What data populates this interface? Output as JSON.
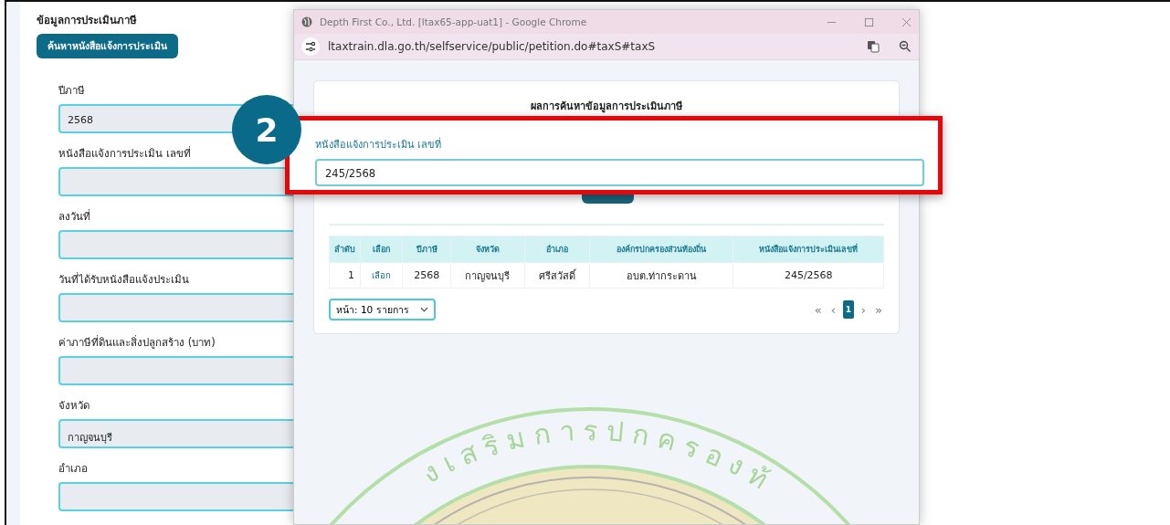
{
  "form": {
    "title": "ข้อมูลการประเมินภาษี",
    "search_button": "ค้นหาหนังสือแจ้งการประเมิน",
    "fields": [
      {
        "label": "ปีภาษี",
        "value": "2568"
      },
      {
        "label": "หนังสือแจ้งการประเมิน เลขที่"
      },
      {
        "label": "ลงวันที่"
      },
      {
        "label": "วันที่ได้รับหนังสือแจ้งประเมิน"
      },
      {
        "label": "ค่าภาษีที่ดินและสิ่งปลูกสร้าง (บาท)"
      },
      {
        "label": "จังหวัด",
        "value": "กาญจนบุรี"
      },
      {
        "label": "อำเภอ"
      }
    ]
  },
  "popup": {
    "window_title": "Depth First Co., Ltd. [ltax65-app-uat1] - Google Chrome",
    "url": "ltaxtrain.dla.go.th/selfservice/public/petition.do#taxS#taxS",
    "card_title": "ผลการค้นหาข้อมูลการประเมินภาษี",
    "table": {
      "columns": [
        "ลำดับ",
        "เลือก",
        "ปีภาษี",
        "จังหวัด",
        "อำเภอ",
        "องค์กรปกครองส่วนท้องถิ่น",
        "หนังสือแจ้งการประเมินเลขที่"
      ],
      "rows": [
        {
          "no": "1",
          "select": "เลือก",
          "year": "2568",
          "province": "กาญจนบุรี",
          "district": "ศรีสวัสดิ์",
          "org": "อบต.ท่ากระดาน",
          "notice": "245/2568"
        }
      ]
    },
    "page_size": "หน้า: 10 รายการ",
    "pagination": {
      "first": "«",
      "prev": "‹",
      "pages": [
        {
          "label": "1",
          "selected": true
        }
      ],
      "next": "›",
      "last": "»"
    },
    "emblem_text": "งเสริมการปกครองท้"
  },
  "highlight": {
    "step": "2",
    "label": "หนังสือแจ้งการประเมิน เลขที่",
    "value": "245/2568"
  }
}
